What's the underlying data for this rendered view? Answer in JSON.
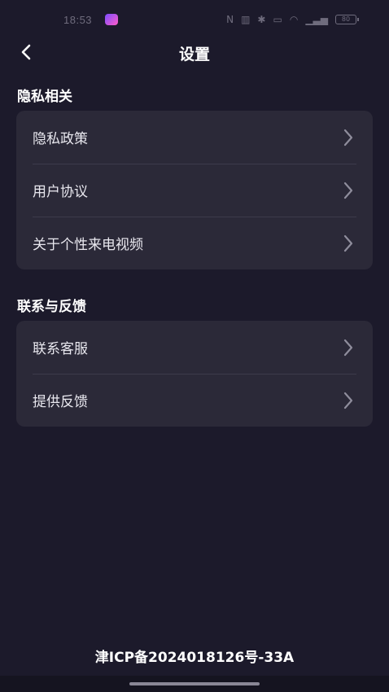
{
  "status_bar": {
    "time": "18:53",
    "battery": "80"
  },
  "nav": {
    "title": "设置",
    "back_icon": "chevron-left-icon"
  },
  "sections": [
    {
      "title": "隐私相关",
      "items": [
        {
          "label": "隐私政策"
        },
        {
          "label": "用户协议"
        },
        {
          "label": "关于个性来电视频"
        }
      ]
    },
    {
      "title": "联系与反馈",
      "items": [
        {
          "label": "联系客服"
        },
        {
          "label": "提供反馈"
        }
      ]
    }
  ],
  "footer": {
    "icp": "津ICP备2024018126号-33A"
  },
  "colors": {
    "background": "#1c1a2b",
    "card": "#2b2938",
    "divider": "#3d3b4b"
  }
}
